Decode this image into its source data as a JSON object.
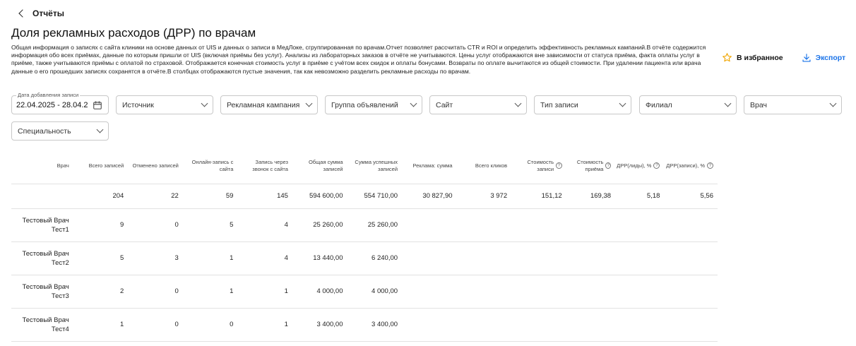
{
  "nav": {
    "back_label": "Отчёты"
  },
  "page": {
    "title": "Доля рекламных расходов (ДРР) по врачам",
    "description": "Общая информация о записях с сайта клиники на основе данных от UIS и данных о записи в МедЛоке, сгруппированная по врачам.Отчет позволяет рассчитать CTR и ROI и определить эффективность рекламных кампаний.В отчёте содержится информация обо всех приёмах, данные по которым пришли от UIS (включая приёмы без услуг). Анализы из лабораторных заказов в отчёте не учитываются. Цены услуг отображаются вне зависимости от статуса приёма, факта оплаты услуг в приёме, также учитываются приёмы с оплатой по страховой. Отображается конечная стоимость услуг в приёме с учётом всех скидок и оплаты бонусами. Возвраты по оплате вычитаются из общей стоимости. При удалении пациента или врача данные о его прошедших записях сохранятся в отчёте.В столбцах отображаются пустые значения, так как невозможно разделить рекламные расходы по врачам."
  },
  "actions": {
    "favorite_label": "В избранное",
    "export_label": "Экспорт",
    "accent_color": "#1a73e8"
  },
  "filters": {
    "date_label": "Дата добавления записи",
    "date_value": "22.04.2025 - 28.04.2",
    "source": "Источник",
    "campaign": "Рекламная кампания",
    "ad_group": "Группа объявлений",
    "site": "Сайт",
    "record_type": "Тип записи",
    "branch": "Филиал",
    "doctor": "Врач",
    "specialty": "Специальность"
  },
  "table": {
    "headers": {
      "doctor": "Врач",
      "total_records": "Всего записей",
      "cancelled": "Отменено записей",
      "online": "Онлайн-запись с сайта",
      "call": "Запись через звонок с сайта",
      "total_sum": "Общая сумма записей",
      "success_sum": "Сумма успешных записей",
      "ad_sum": "Реклама: сумма",
      "clicks": "Всего кликов",
      "cost_record": "Стоимость записи",
      "cost_visit": "Стоимость приёма",
      "drr_leads": "ДРР(лиды), %",
      "drr_records": "ДРР(записи), %"
    },
    "total": {
      "doctor": "",
      "total_records": "204",
      "cancelled": "22",
      "online": "59",
      "call": "145",
      "total_sum": "594 600,00",
      "success_sum": "554 710,00",
      "ad_sum": "30 827,90",
      "clicks": "3 972",
      "cost_record": "151,12",
      "cost_visit": "169,38",
      "drr_leads": "5,18",
      "drr_records": "5,56"
    },
    "rows": [
      {
        "doctor": "Тестовый Врач Тест1",
        "total_records": "9",
        "cancelled": "0",
        "online": "5",
        "call": "4",
        "total_sum": "25 260,00",
        "success_sum": "25 260,00"
      },
      {
        "doctor": "Тестовый Врач Тест2",
        "total_records": "5",
        "cancelled": "3",
        "online": "1",
        "call": "4",
        "total_sum": "13 440,00",
        "success_sum": "6 240,00"
      },
      {
        "doctor": "Тестовый Врач Тест3",
        "total_records": "2",
        "cancelled": "0",
        "online": "1",
        "call": "1",
        "total_sum": "4 000,00",
        "success_sum": "4 000,00"
      },
      {
        "doctor": "Тестовый Врач Тест4",
        "total_records": "1",
        "cancelled": "0",
        "online": "0",
        "call": "1",
        "total_sum": "3 400,00",
        "success_sum": "3 400,00"
      }
    ]
  }
}
